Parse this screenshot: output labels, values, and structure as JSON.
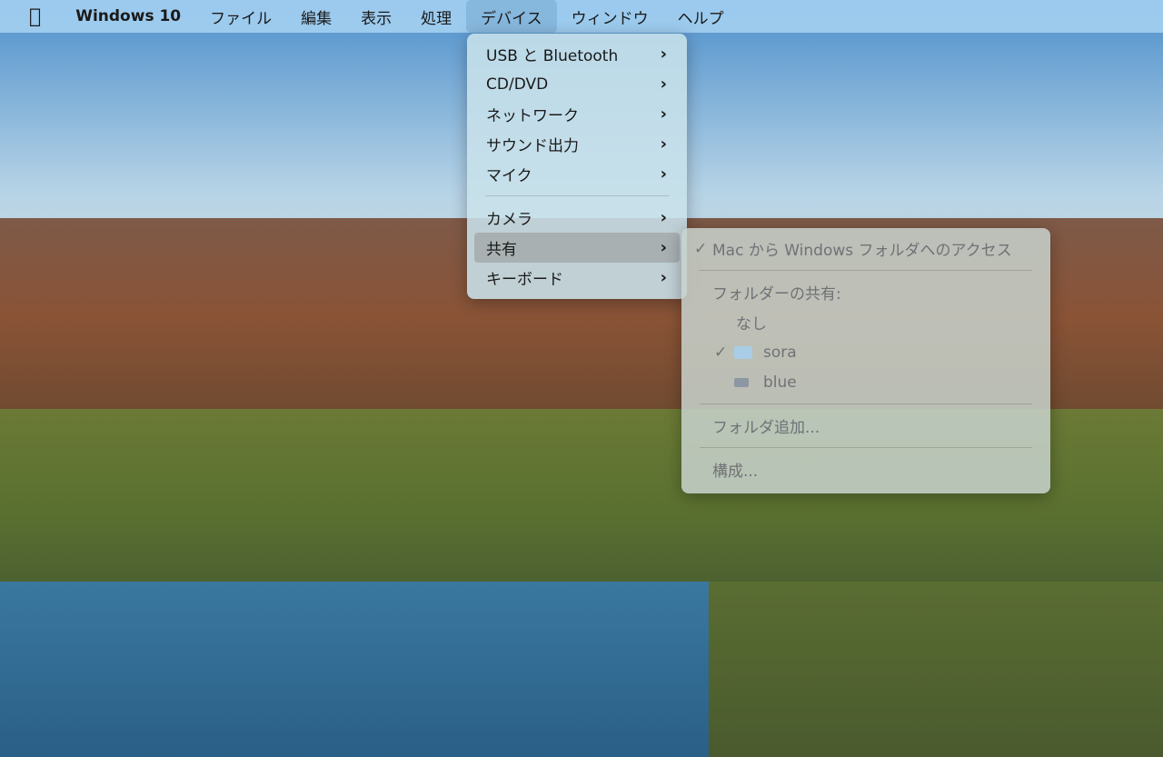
{
  "menubar": {
    "app": "Windows 10",
    "items": [
      "ファイル",
      "編集",
      "表示",
      "処理",
      "デバイス",
      "ウィンドウ",
      "ヘルプ"
    ]
  },
  "devices_menu": {
    "items": [
      {
        "label": "USB と Bluetooth"
      },
      {
        "label": "CD/DVD"
      },
      {
        "label": "ネットワーク"
      },
      {
        "label": "サウンド出力"
      },
      {
        "label": "マイク"
      },
      {
        "label": "カメラ"
      },
      {
        "label": "共有"
      },
      {
        "label": "キーボード"
      }
    ]
  },
  "sharing_menu": {
    "access": "Mac から Windows フォルダへのアクセス",
    "header": "フォルダーの共有:",
    "none": "なし",
    "folders": [
      "sora",
      "blue"
    ],
    "add": "フォルダ追加...",
    "configure": "構成...",
    "check": "✓"
  }
}
